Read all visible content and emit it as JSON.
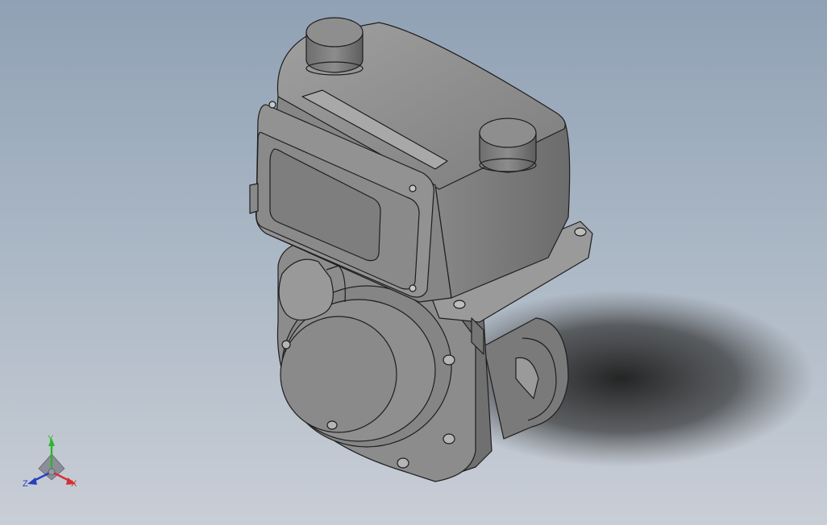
{
  "viewport": {
    "background_top": "#90a1b5",
    "background_bottom": "#c9ced6",
    "model_color": "#8a8a8a",
    "edge_color": "#1e1e1e"
  },
  "model": {
    "icon": "gas-meter-3d-model"
  },
  "triad": {
    "icon": "coordinate-triad-icon",
    "x_label": "X",
    "y_label": "Y",
    "z_label": "Z",
    "x_color": "#d23232",
    "y_color": "#2db52d",
    "z_color": "#2a3fbf"
  }
}
